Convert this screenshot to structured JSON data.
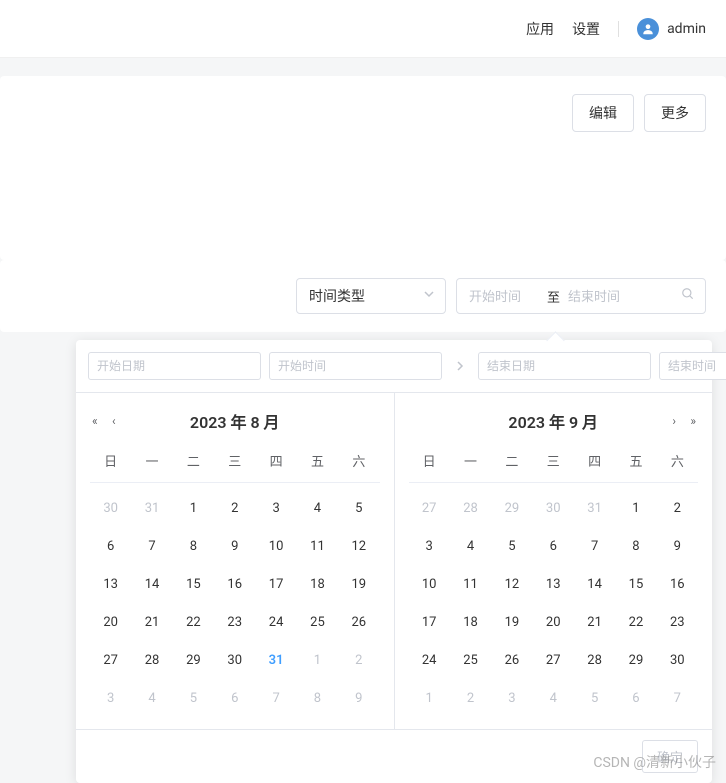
{
  "header": {
    "app_link": "应用",
    "settings_link": "设置",
    "user_name": "admin"
  },
  "card": {
    "edit_btn": "编辑",
    "more_btn": "更多"
  },
  "filter": {
    "select_label": "时间类型",
    "range_start_ph": "开始时间",
    "range_sep": "至",
    "range_end_ph": "结束时间"
  },
  "datepicker": {
    "start_date_ph": "开始日期",
    "start_time_ph": "开始时间",
    "end_date_ph": "结束日期",
    "end_time_ph": "结束时间",
    "confirm": "确定",
    "weekdays": [
      "日",
      "一",
      "二",
      "三",
      "四",
      "五",
      "六"
    ],
    "left": {
      "title": "2023 年 8 月",
      "days": [
        {
          "d": "30",
          "o": true
        },
        {
          "d": "31",
          "o": true
        },
        {
          "d": "1"
        },
        {
          "d": "2"
        },
        {
          "d": "3"
        },
        {
          "d": "4"
        },
        {
          "d": "5"
        },
        {
          "d": "6"
        },
        {
          "d": "7"
        },
        {
          "d": "8"
        },
        {
          "d": "9"
        },
        {
          "d": "10"
        },
        {
          "d": "11"
        },
        {
          "d": "12"
        },
        {
          "d": "13"
        },
        {
          "d": "14"
        },
        {
          "d": "15"
        },
        {
          "d": "16"
        },
        {
          "d": "17"
        },
        {
          "d": "18"
        },
        {
          "d": "19"
        },
        {
          "d": "20"
        },
        {
          "d": "21"
        },
        {
          "d": "22"
        },
        {
          "d": "23"
        },
        {
          "d": "24"
        },
        {
          "d": "25"
        },
        {
          "d": "26"
        },
        {
          "d": "27"
        },
        {
          "d": "28"
        },
        {
          "d": "29"
        },
        {
          "d": "30"
        },
        {
          "d": "31",
          "t": true
        },
        {
          "d": "1",
          "o": true
        },
        {
          "d": "2",
          "o": true
        },
        {
          "d": "3",
          "o": true
        },
        {
          "d": "4",
          "o": true
        },
        {
          "d": "5",
          "o": true
        },
        {
          "d": "6",
          "o": true
        },
        {
          "d": "7",
          "o": true
        },
        {
          "d": "8",
          "o": true
        },
        {
          "d": "9",
          "o": true
        }
      ]
    },
    "right": {
      "title": "2023 年 9 月",
      "days": [
        {
          "d": "27",
          "o": true
        },
        {
          "d": "28",
          "o": true
        },
        {
          "d": "29",
          "o": true
        },
        {
          "d": "30",
          "o": true
        },
        {
          "d": "31",
          "o": true
        },
        {
          "d": "1"
        },
        {
          "d": "2"
        },
        {
          "d": "3"
        },
        {
          "d": "4"
        },
        {
          "d": "5"
        },
        {
          "d": "6"
        },
        {
          "d": "7"
        },
        {
          "d": "8"
        },
        {
          "d": "9"
        },
        {
          "d": "10"
        },
        {
          "d": "11"
        },
        {
          "d": "12"
        },
        {
          "d": "13"
        },
        {
          "d": "14"
        },
        {
          "d": "15"
        },
        {
          "d": "16"
        },
        {
          "d": "17"
        },
        {
          "d": "18"
        },
        {
          "d": "19"
        },
        {
          "d": "20"
        },
        {
          "d": "21"
        },
        {
          "d": "22"
        },
        {
          "d": "23"
        },
        {
          "d": "24"
        },
        {
          "d": "25"
        },
        {
          "d": "26"
        },
        {
          "d": "27"
        },
        {
          "d": "28"
        },
        {
          "d": "29"
        },
        {
          "d": "30"
        },
        {
          "d": "1",
          "o": true
        },
        {
          "d": "2",
          "o": true
        },
        {
          "d": "3",
          "o": true
        },
        {
          "d": "4",
          "o": true
        },
        {
          "d": "5",
          "o": true
        },
        {
          "d": "6",
          "o": true
        },
        {
          "d": "7",
          "o": true
        }
      ]
    }
  },
  "watermark": "CSDN @清新小伙子"
}
